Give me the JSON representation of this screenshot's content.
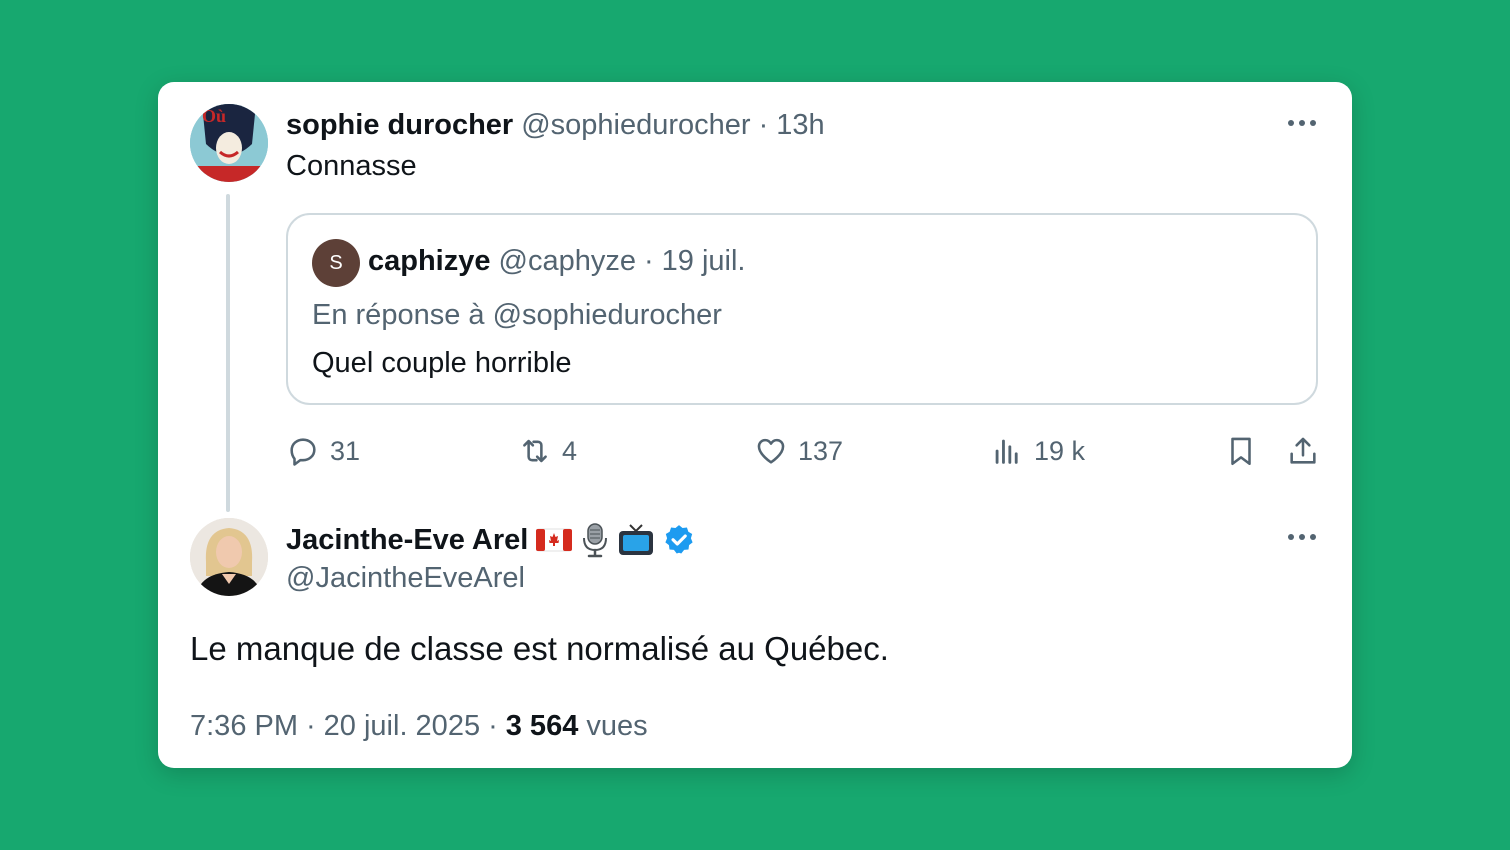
{
  "parent_tweet": {
    "display_name": "sophie durocher",
    "handle": "@sophiedurocher",
    "separator": "·",
    "time": "13h",
    "text": "Connasse",
    "avatar_text": "Où sont les femmes?",
    "quote": {
      "avatar_initial": "S",
      "display_name": "caphizye",
      "handle": "@caphyze",
      "separator": "·",
      "time": "19 juil.",
      "reply_to": "En réponse à @sophiedurocher",
      "text": "Quel couple horrible"
    },
    "actions": {
      "replies": "31",
      "reposts": "4",
      "likes": "137",
      "views": "19 k"
    }
  },
  "main_tweet": {
    "display_name": "Jacinthe-Eve Arel",
    "handle": "@JacintheEveArel",
    "text": "Le manque de classe est normalisé au Québec.",
    "time": "7:36 PM",
    "separator": "·",
    "date": "20 juil. 2025",
    "views_count": "3 564",
    "views_label": "vues",
    "badges": [
      "canada-flag-icon",
      "microphone-icon",
      "television-icon",
      "verified-badge-icon"
    ],
    "verified_color": "#1d9bf0"
  },
  "colors": {
    "background": "#17a86f",
    "card": "#ffffff",
    "muted_text": "#536471"
  }
}
